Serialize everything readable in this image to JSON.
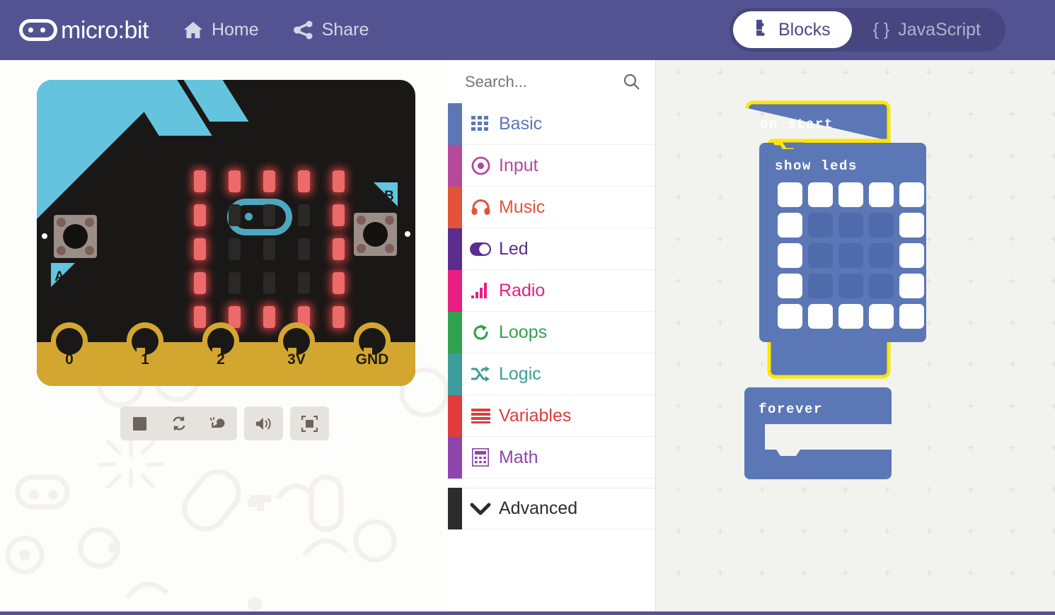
{
  "header": {
    "brand": "micro:bit",
    "brand_icon": "microbit-logo-icon",
    "nav": [
      {
        "label": "Home",
        "icon": "home-icon"
      },
      {
        "label": "Share",
        "icon": "share-icon"
      }
    ],
    "mode_toggle": {
      "blocks_label": "Blocks",
      "blocks_icon": "puzzle-piece-icon",
      "javascript_label": "JavaScript",
      "javascript_icon": "curly-braces-icon",
      "active": "Blocks"
    },
    "bg_color": "#545392",
    "toggle_bg_color": "#474680"
  },
  "simulator": {
    "board": {
      "body_color": "#1a1817",
      "accent_color": "#64c4dd",
      "connector_color": "#d3a72f",
      "led_on_color": "#ec6a6a",
      "led_off_color": "#2b2927",
      "button_a_label": "A",
      "button_b_label": "B",
      "pins": [
        "0",
        "1",
        "2",
        "3V",
        "GND"
      ],
      "led_matrix": [
        [
          1,
          1,
          1,
          1,
          1
        ],
        [
          1,
          0,
          0,
          0,
          1
        ],
        [
          1,
          0,
          0,
          0,
          1
        ],
        [
          1,
          0,
          0,
          0,
          1
        ],
        [
          1,
          1,
          1,
          1,
          1
        ]
      ]
    },
    "controls": [
      {
        "name": "stop-button",
        "icon": "stop-square-icon"
      },
      {
        "name": "restart-button",
        "icon": "restart-refresh-icon"
      },
      {
        "name": "slow-motion-button",
        "icon": "snail-icon"
      },
      {
        "name": "mute-button",
        "icon": "speaker-icon"
      },
      {
        "name": "fullscreen-button",
        "icon": "fullscreen-icon"
      }
    ]
  },
  "toolbox": {
    "search_placeholder": "Search...",
    "search_value": "",
    "search_icon": "search-magnifier-icon",
    "categories": [
      {
        "label": "Basic",
        "color": "#5c77b6",
        "icon": "grid-dots-icon"
      },
      {
        "label": "Input",
        "color": "#b4499b",
        "icon": "target-circle-icon"
      },
      {
        "label": "Music",
        "color": "#e2533a",
        "icon": "headphones-icon"
      },
      {
        "label": "Led",
        "color": "#5b2d8e",
        "icon": "toggle-switch-icon"
      },
      {
        "label": "Radio",
        "color": "#e91e82",
        "icon": "signal-bars-icon"
      },
      {
        "label": "Loops",
        "color": "#31a24c",
        "icon": "loop-arrow-icon"
      },
      {
        "label": "Logic",
        "color": "#3d9c9c",
        "icon": "shuffle-arrows-icon"
      },
      {
        "label": "Variables",
        "color": "#e03c3c",
        "icon": "stacked-lines-icon"
      },
      {
        "label": "Math",
        "color": "#8e44ad",
        "icon": "calculator-icon"
      }
    ],
    "advanced": {
      "label": "Advanced",
      "color": "#2c2c2c",
      "icon": "chevron-down-icon"
    }
  },
  "workspace": {
    "bg_color": "#f2f2ef",
    "block_color": "#5c77b6",
    "selection_color": "#ffe600",
    "blocks": [
      {
        "name": "on-start",
        "label": "on start",
        "selected": true,
        "child": {
          "name": "show-leds",
          "label": "show leds",
          "matrix": [
            [
              1,
              1,
              1,
              1,
              1
            ],
            [
              1,
              0,
              0,
              0,
              1
            ],
            [
              1,
              0,
              0,
              0,
              1
            ],
            [
              1,
              0,
              0,
              0,
              1
            ],
            [
              1,
              1,
              1,
              1,
              1
            ]
          ]
        }
      },
      {
        "name": "forever",
        "label": "forever",
        "selected": false,
        "child": null
      }
    ]
  }
}
